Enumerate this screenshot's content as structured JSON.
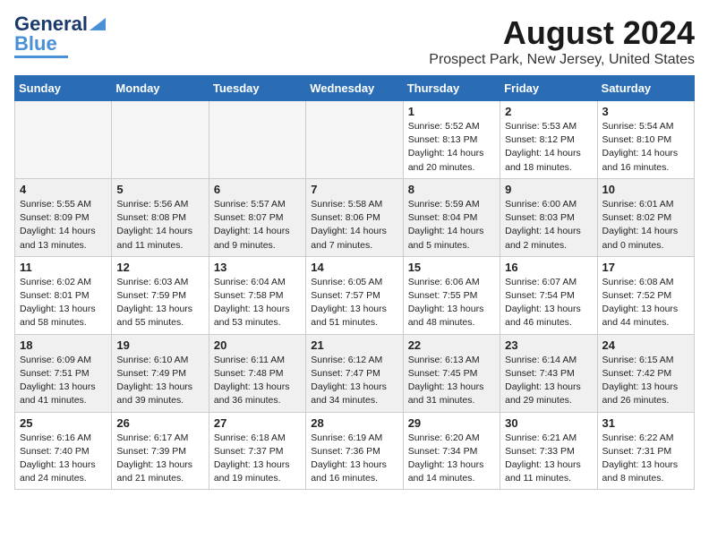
{
  "logo": {
    "line1": "General",
    "line2": "Blue"
  },
  "title": "August 2024",
  "location": "Prospect Park, New Jersey, United States",
  "days_of_week": [
    "Sunday",
    "Monday",
    "Tuesday",
    "Wednesday",
    "Thursday",
    "Friday",
    "Saturday"
  ],
  "weeks": [
    [
      {
        "day": "",
        "info": "",
        "empty": true
      },
      {
        "day": "",
        "info": "",
        "empty": true
      },
      {
        "day": "",
        "info": "",
        "empty": true
      },
      {
        "day": "",
        "info": "",
        "empty": true
      },
      {
        "day": "1",
        "info": "Sunrise: 5:52 AM\nSunset: 8:13 PM\nDaylight: 14 hours\nand 20 minutes."
      },
      {
        "day": "2",
        "info": "Sunrise: 5:53 AM\nSunset: 8:12 PM\nDaylight: 14 hours\nand 18 minutes."
      },
      {
        "day": "3",
        "info": "Sunrise: 5:54 AM\nSunset: 8:10 PM\nDaylight: 14 hours\nand 16 minutes."
      }
    ],
    [
      {
        "day": "4",
        "info": "Sunrise: 5:55 AM\nSunset: 8:09 PM\nDaylight: 14 hours\nand 13 minutes."
      },
      {
        "day": "5",
        "info": "Sunrise: 5:56 AM\nSunset: 8:08 PM\nDaylight: 14 hours\nand 11 minutes."
      },
      {
        "day": "6",
        "info": "Sunrise: 5:57 AM\nSunset: 8:07 PM\nDaylight: 14 hours\nand 9 minutes."
      },
      {
        "day": "7",
        "info": "Sunrise: 5:58 AM\nSunset: 8:06 PM\nDaylight: 14 hours\nand 7 minutes."
      },
      {
        "day": "8",
        "info": "Sunrise: 5:59 AM\nSunset: 8:04 PM\nDaylight: 14 hours\nand 5 minutes."
      },
      {
        "day": "9",
        "info": "Sunrise: 6:00 AM\nSunset: 8:03 PM\nDaylight: 14 hours\nand 2 minutes."
      },
      {
        "day": "10",
        "info": "Sunrise: 6:01 AM\nSunset: 8:02 PM\nDaylight: 14 hours\nand 0 minutes."
      }
    ],
    [
      {
        "day": "11",
        "info": "Sunrise: 6:02 AM\nSunset: 8:01 PM\nDaylight: 13 hours\nand 58 minutes."
      },
      {
        "day": "12",
        "info": "Sunrise: 6:03 AM\nSunset: 7:59 PM\nDaylight: 13 hours\nand 55 minutes."
      },
      {
        "day": "13",
        "info": "Sunrise: 6:04 AM\nSunset: 7:58 PM\nDaylight: 13 hours\nand 53 minutes."
      },
      {
        "day": "14",
        "info": "Sunrise: 6:05 AM\nSunset: 7:57 PM\nDaylight: 13 hours\nand 51 minutes."
      },
      {
        "day": "15",
        "info": "Sunrise: 6:06 AM\nSunset: 7:55 PM\nDaylight: 13 hours\nand 48 minutes."
      },
      {
        "day": "16",
        "info": "Sunrise: 6:07 AM\nSunset: 7:54 PM\nDaylight: 13 hours\nand 46 minutes."
      },
      {
        "day": "17",
        "info": "Sunrise: 6:08 AM\nSunset: 7:52 PM\nDaylight: 13 hours\nand 44 minutes."
      }
    ],
    [
      {
        "day": "18",
        "info": "Sunrise: 6:09 AM\nSunset: 7:51 PM\nDaylight: 13 hours\nand 41 minutes."
      },
      {
        "day": "19",
        "info": "Sunrise: 6:10 AM\nSunset: 7:49 PM\nDaylight: 13 hours\nand 39 minutes."
      },
      {
        "day": "20",
        "info": "Sunrise: 6:11 AM\nSunset: 7:48 PM\nDaylight: 13 hours\nand 36 minutes."
      },
      {
        "day": "21",
        "info": "Sunrise: 6:12 AM\nSunset: 7:47 PM\nDaylight: 13 hours\nand 34 minutes."
      },
      {
        "day": "22",
        "info": "Sunrise: 6:13 AM\nSunset: 7:45 PM\nDaylight: 13 hours\nand 31 minutes."
      },
      {
        "day": "23",
        "info": "Sunrise: 6:14 AM\nSunset: 7:43 PM\nDaylight: 13 hours\nand 29 minutes."
      },
      {
        "day": "24",
        "info": "Sunrise: 6:15 AM\nSunset: 7:42 PM\nDaylight: 13 hours\nand 26 minutes."
      }
    ],
    [
      {
        "day": "25",
        "info": "Sunrise: 6:16 AM\nSunset: 7:40 PM\nDaylight: 13 hours\nand 24 minutes."
      },
      {
        "day": "26",
        "info": "Sunrise: 6:17 AM\nSunset: 7:39 PM\nDaylight: 13 hours\nand 21 minutes."
      },
      {
        "day": "27",
        "info": "Sunrise: 6:18 AM\nSunset: 7:37 PM\nDaylight: 13 hours\nand 19 minutes."
      },
      {
        "day": "28",
        "info": "Sunrise: 6:19 AM\nSunset: 7:36 PM\nDaylight: 13 hours\nand 16 minutes."
      },
      {
        "day": "29",
        "info": "Sunrise: 6:20 AM\nSunset: 7:34 PM\nDaylight: 13 hours\nand 14 minutes."
      },
      {
        "day": "30",
        "info": "Sunrise: 6:21 AM\nSunset: 7:33 PM\nDaylight: 13 hours\nand 11 minutes."
      },
      {
        "day": "31",
        "info": "Sunrise: 6:22 AM\nSunset: 7:31 PM\nDaylight: 13 hours\nand 8 minutes."
      }
    ]
  ]
}
